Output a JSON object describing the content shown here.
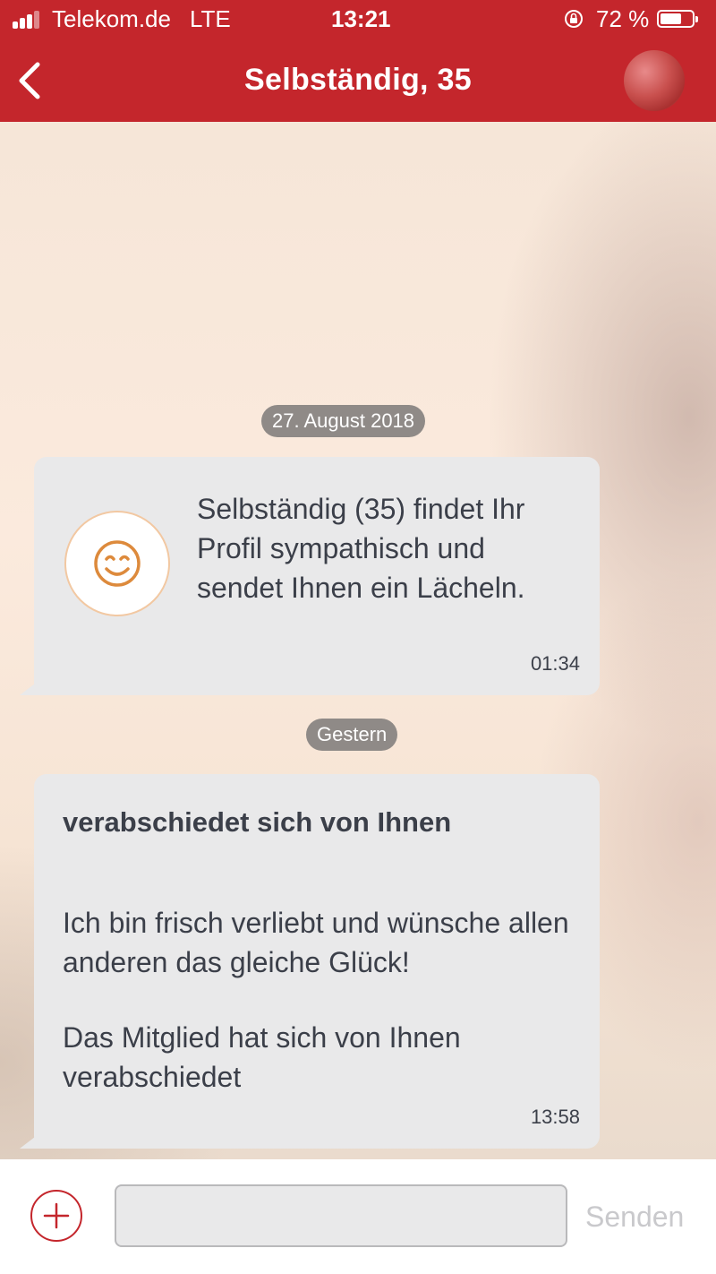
{
  "status_bar": {
    "carrier": "Telekom.de",
    "network": "LTE",
    "time": "13:21",
    "battery_percent": "72 %",
    "battery_level": 0.72
  },
  "header": {
    "title": "Selbständig, 35",
    "back_icon": "chevron-left-icon",
    "avatar_icon": "profile-avatar"
  },
  "chat": {
    "date_1": "27. August 2018",
    "message_1": {
      "icon": "smile-icon",
      "text": "Selbständig (35) findet Ihr Profil sympathisch und sendet Ihnen ein Lächeln.",
      "time": "01:34"
    },
    "date_2": "Gestern",
    "message_2": {
      "heading": "verabschiedet sich von Ihnen",
      "paragraph_1": "Ich bin frisch verliebt und wünsche allen anderen das gleiche Glück!",
      "paragraph_2": "Das Mitglied hat sich von Ihnen verabschiedet",
      "time": "13:58"
    }
  },
  "composer": {
    "add_icon": "plus-icon",
    "input_value": "",
    "send_label": "Senden"
  },
  "colors": {
    "brand_red": "#c4262c",
    "bubble": "#e9e9ea",
    "smile_orange": "#dd8a3c",
    "date_pill": "#8f8a87"
  }
}
